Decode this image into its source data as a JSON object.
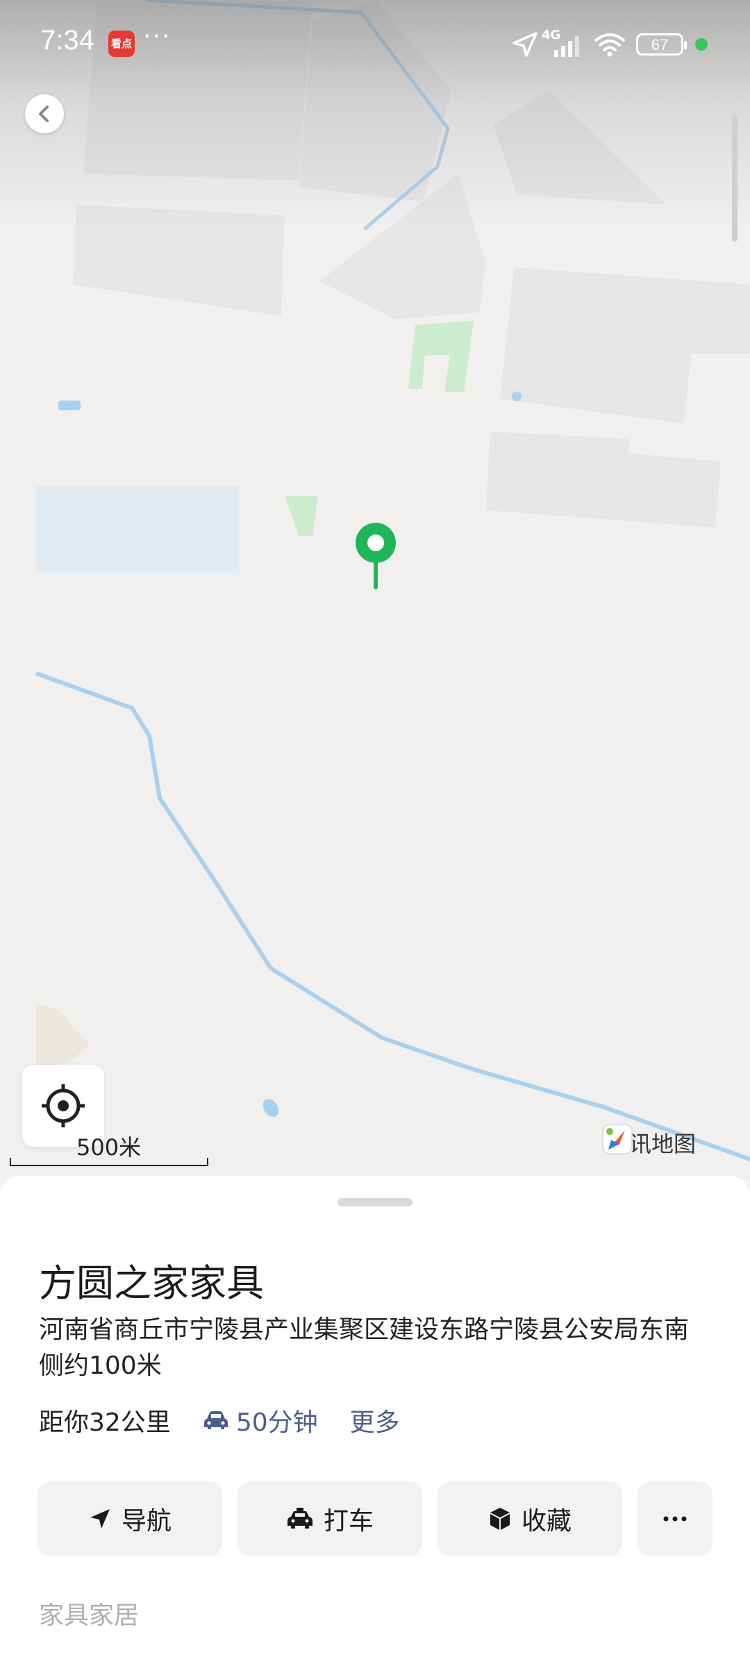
{
  "status_bar": {
    "time": "7:34",
    "app_badge": "看点",
    "more": "···",
    "network": "4G",
    "battery": "67"
  },
  "map": {
    "scale_label": "500米",
    "brand": "腾讯地图"
  },
  "place": {
    "name": "方圆之家家具",
    "address": "河南省商丘市宁陵县产业集聚区建设东路宁陵县公安局东南侧约100米",
    "distance": "距你32公里",
    "drive_time": "50分钟",
    "more": "更多",
    "category": "家具家居"
  },
  "actions": {
    "navigate": "导航",
    "taxi": "打车",
    "favorite": "收藏"
  },
  "colors": {
    "accent": "#4a5f8d",
    "pin": "#1fb55a",
    "water": "#a9d0ee",
    "green_area": "#cdeccd"
  }
}
